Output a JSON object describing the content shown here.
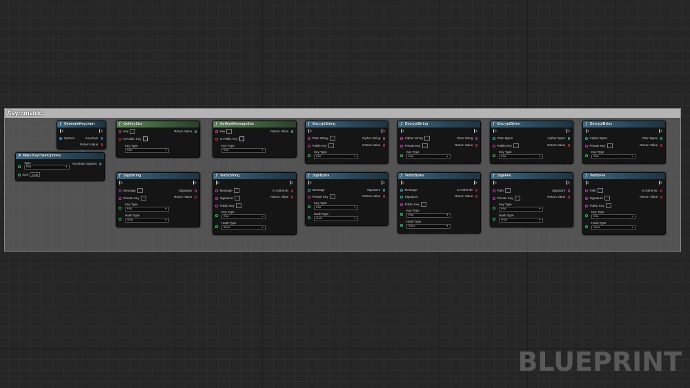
{
  "comment": {
    "title": "Asymmetric"
  },
  "watermark": "BLUEPRINT",
  "nodes": {
    "generate_keychain": {
      "title": "GenerateKeychain",
      "in": [
        "Options"
      ],
      "out": [
        "Keychain",
        "Return Value"
      ]
    },
    "make_keychain_options": {
      "title": "Make KeychainOptions",
      "type_label": "Type",
      "type_value": "RSA",
      "size_label": "Size",
      "size_value": "2048",
      "out": "Keychain Options"
    },
    "get_key_size": {
      "title": "GetKeySize",
      "key": "Key",
      "is_public_key": "Is Public Key",
      "key_type": "Key Type",
      "key_type_value": "RSA",
      "return_value": "Return Value"
    },
    "get_max_message_size": {
      "title": "GetMaxMessageSize",
      "key": "Key",
      "is_public_key": "Is Public Key",
      "key_type": "Key Type",
      "key_type_value": "RSA",
      "return_value": "Return Value"
    },
    "encrypt_string": {
      "title": "EncryptString",
      "in1": "Plain String",
      "in2": "Public Key",
      "key_type": "Key Type",
      "key_type_value": "RSA",
      "out1": "Cipher String",
      "out2": "Return Value"
    },
    "decrypt_string": {
      "title": "DecryptString",
      "in1": "Cipher String",
      "in2": "Private Key",
      "key_type": "Key Type",
      "key_type_value": "RSA",
      "out1": "Plain String",
      "out2": "Return Value"
    },
    "encrypt_bytes": {
      "title": "EncryptBytes",
      "in1": "Plain Bytes",
      "in2": "Public Key",
      "key_type": "Key Type",
      "key_type_value": "RSA",
      "out1": "Cipher Bytes",
      "out2": "Return Value"
    },
    "decrypt_bytes": {
      "title": "DecryptBytes",
      "in1": "Cipher Bytes",
      "in2": "Private Key",
      "key_type": "Key Type",
      "key_type_value": "RSA",
      "out1": "Plain Bytes",
      "out2": "Return Value"
    },
    "sign_string": {
      "title": "SignString",
      "in1": "Message",
      "in2": "Private Key",
      "key_type": "Key Type",
      "key_type_value": "RSA",
      "hash_type": "Hash Type",
      "hash_type_value": "SHA1",
      "out1": "Signature",
      "out2": "Return Value"
    },
    "verify_string": {
      "title": "VerifyString",
      "in1": "Message",
      "in2": "Signature",
      "in3": "Public Key",
      "key_type": "Key Type",
      "key_type_value": "RSA",
      "hash_type": "Hash Type",
      "hash_type_value": "SHA1",
      "out1": "Is Authentic",
      "out2": "Return Value"
    },
    "sign_bytes": {
      "title": "SignBytes",
      "in1": "Message",
      "in2": "Private Key",
      "key_type": "Key Type",
      "key_type_value": "RSA",
      "hash_type": "Hash Type",
      "hash_type_value": "SHA1",
      "out1": "Signature",
      "out2": "Return Value"
    },
    "verify_bytes": {
      "title": "VerifyBytes",
      "in1": "Message",
      "in2": "Signature",
      "in3": "Public Key",
      "key_type": "Key Type",
      "key_type_value": "RSA",
      "hash_type": "Hash Type",
      "hash_type_value": "SHA1",
      "out1": "Is Authentic",
      "out2": "Return Value"
    },
    "sign_file": {
      "title": "SignFile",
      "in1": "Path",
      "in2": "Private Key",
      "key_type": "Key Type",
      "key_type_value": "RSA",
      "hash_type": "Hash Type",
      "hash_type_value": "SHA1",
      "out1": "Signature",
      "out2": "Return Value"
    },
    "verify_file": {
      "title": "VerifyFile",
      "in1": "Path",
      "in2": "Signature",
      "in3": "Public Key",
      "key_type": "Key Type",
      "key_type_value": "RSA",
      "hash_type": "Hash Type",
      "hash_type_value": "SHA1",
      "out1": "Is Authentic",
      "out2": "Return Value"
    }
  },
  "colors": {
    "header_blue": "#3f6c88",
    "header_green": "#5f8a5c",
    "pin_pink": "#c13bb2",
    "pin_blue": "#2f87d8",
    "pin_green": "#31c66b",
    "pin_red": "#c0302e"
  },
  "icons": {
    "function": "function-icon",
    "exec": "exec-pin-icon"
  }
}
